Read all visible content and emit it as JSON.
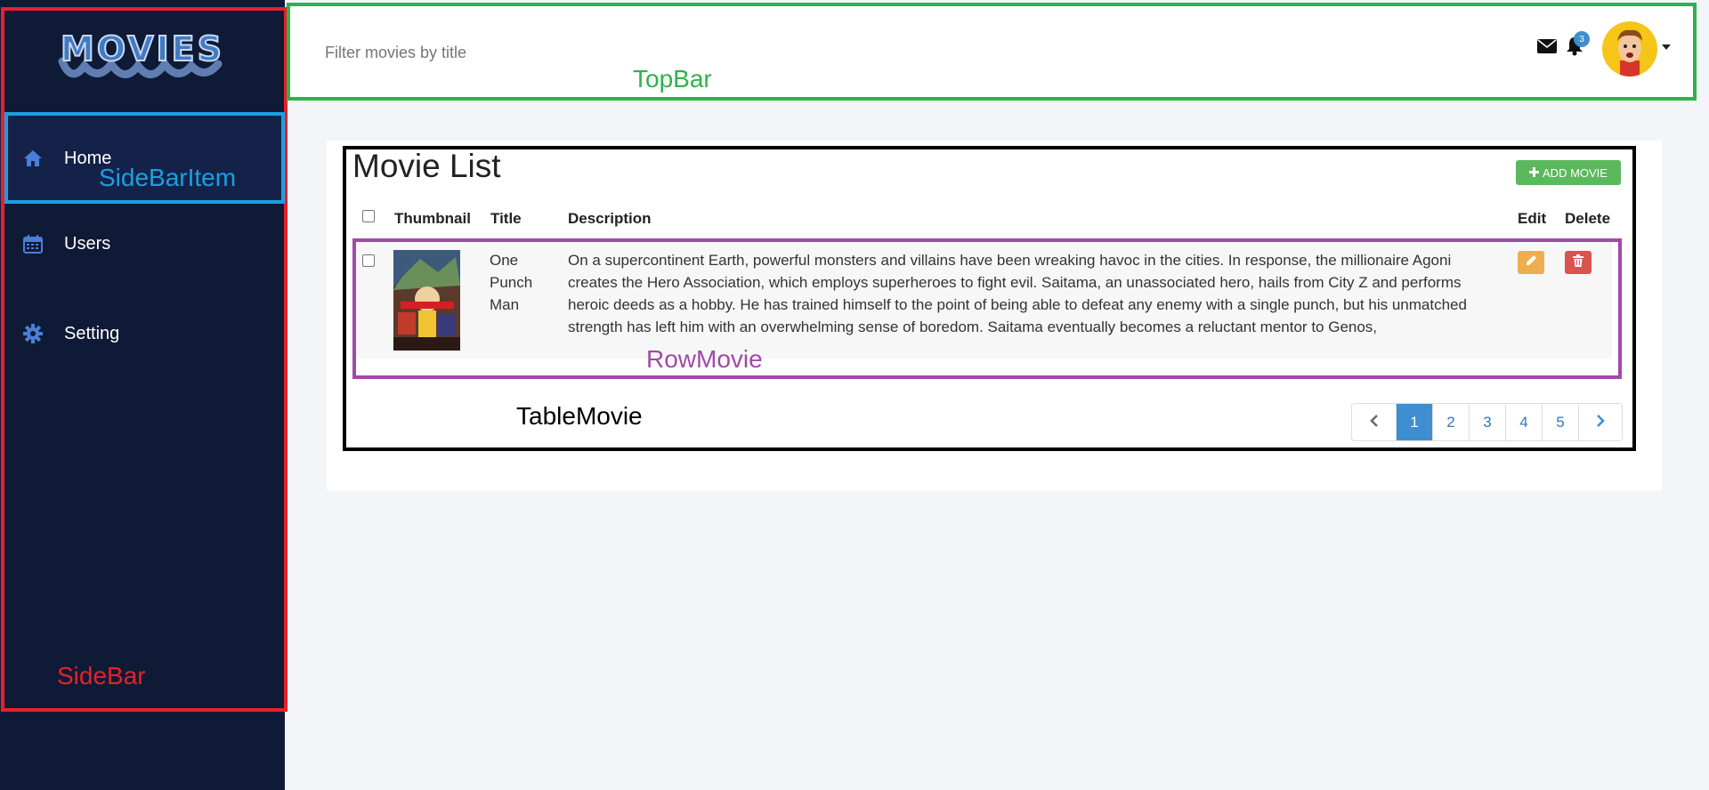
{
  "sidebar": {
    "logo_text": "MOVIES",
    "items": [
      {
        "label": "Home",
        "icon": "home-icon"
      },
      {
        "label": "Users",
        "icon": "calendar-icon"
      },
      {
        "label": "Setting",
        "icon": "gear-icon"
      }
    ]
  },
  "topbar": {
    "search_placeholder": "Filter movies by title",
    "notification_count": "3"
  },
  "main": {
    "title": "Movie List",
    "add_button_label": "ADD MOVIE",
    "columns": [
      "Thumbnail",
      "Title",
      "Description",
      "Edit",
      "Delete"
    ],
    "rows": [
      {
        "title": "One Punch Man",
        "description": "On a supercontinent Earth, powerful monsters and villains have been wreaking havoc in the cities. In response, the millionaire Agoni creates the Hero Association, which employs superheroes to fight evil. Saitama, an unassociated hero, hails from City Z and performs heroic deeds as a hobby. He has trained himself to the point of being able to defeat any enemy with a single punch, but his unmatched strength has left him with an overwhelming sense of boredom. Saitama eventually becomes a reluctant mentor to Genos,"
      }
    ],
    "pagination": {
      "pages": [
        "1",
        "2",
        "3",
        "4",
        "5"
      ],
      "active": "1"
    }
  },
  "annotations": {
    "sidebar": "SideBar",
    "sidebar_item": "SideBarItem",
    "topbar": "TopBar",
    "table": "TableMovie",
    "row": "RowMovie"
  },
  "colors": {
    "sidebar_bg": "#0f1a36",
    "accent_blue": "#3e8ed0",
    "add_green": "#5cb85c",
    "edit_orange": "#f0ad4e",
    "delete_red": "#d9534f",
    "anno_sidebar": "#e8202a",
    "anno_sidebar_item": "#1aa0e0",
    "anno_topbar": "#2db34a",
    "anno_table": "#000000",
    "anno_row": "#a04aa8"
  }
}
